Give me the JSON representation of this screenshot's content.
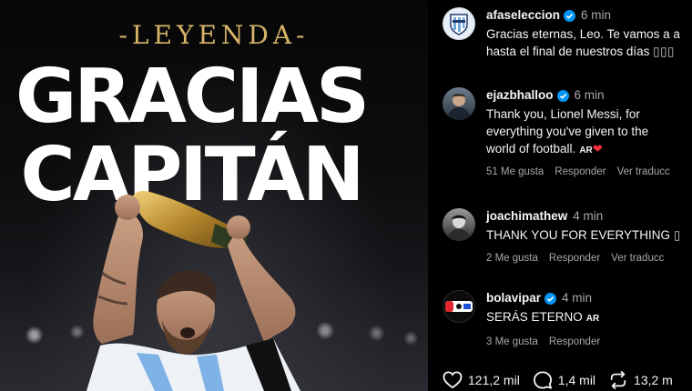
{
  "post": {
    "kicker": "-LEYENDA-",
    "headline_1": "GRACIAS",
    "headline_2": "CAPITÁN"
  },
  "comments": [
    {
      "username": "afaseleccion",
      "time": "6 min",
      "text_lines": [
        "Gracias eternas, Leo. Te vamos a a",
        "hasta el final de nuestros días"
      ],
      "trailing_glyphs": "▯▯▯",
      "avatar": "afa-crest"
    },
    {
      "username": "ejazbhalloo",
      "time": "6 min",
      "text_lines": [
        "Thank you, Lionel Messi, for",
        "everything you've given to the",
        "world of football."
      ],
      "badge": "AR",
      "likes": "51 Me gusta",
      "reply": "Responder",
      "translate": "Ver traducc",
      "avatar": "person-photo"
    },
    {
      "username": "joachimathew",
      "time": "4 min",
      "text_lines": [
        "THANK YOU FOR EVERYTHING"
      ],
      "trailing_glyphs": "▯",
      "likes": "2 Me gusta",
      "reply": "Responder",
      "translate": "Ver traducc",
      "avatar": "person-photo-bw"
    },
    {
      "username": "bolavipar",
      "time": "4 min",
      "text_lines": [
        "SERÁS ETERNO"
      ],
      "badge": "AR",
      "likes": "3 Me gusta",
      "reply": "Responder",
      "avatar": "bolavip-logo"
    }
  ],
  "stats": {
    "likes": "121,2 mil",
    "comments": "1,4 mil",
    "reposts": "13,2 m"
  },
  "colors": {
    "background": "#000000",
    "verified": "#0095f6",
    "gold": "#d7b46a",
    "heart": "#ff3040",
    "secondary_text": "#a8a8a8"
  }
}
